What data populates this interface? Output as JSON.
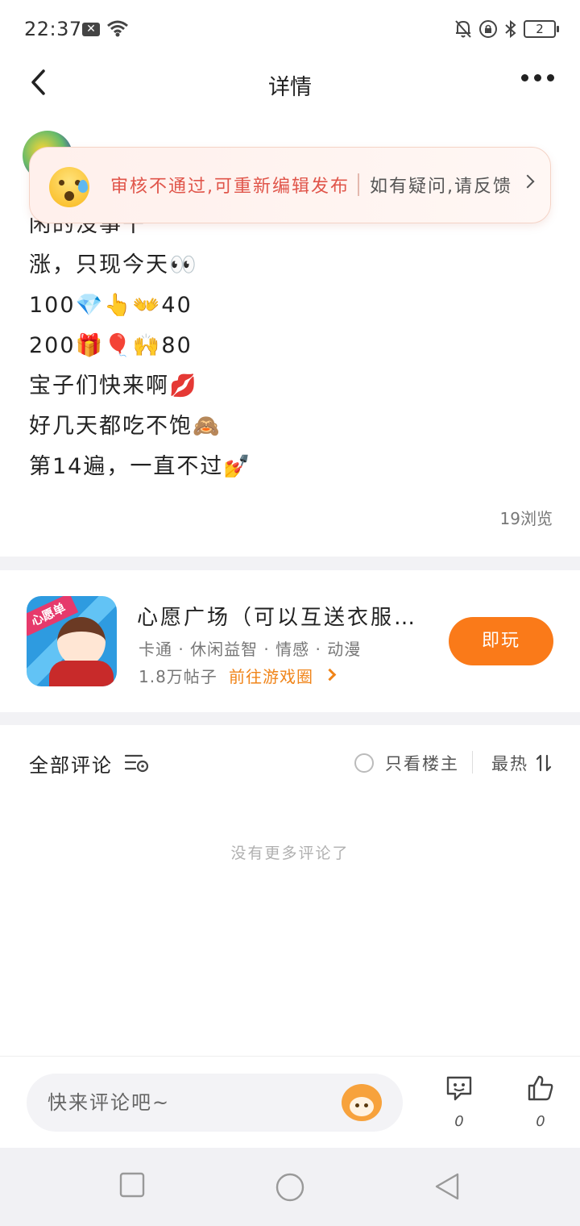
{
  "status_bar": {
    "time": "22:37",
    "notification_icon": "x-box-icon",
    "battery": "2"
  },
  "nav": {
    "title": "详情",
    "back_icon": "chevron-left-icon",
    "more_icon": "more-horizontal-icon"
  },
  "post": {
    "lines": [
      "闲的没事干",
      "涨，只现今天👀",
      "100💎👆👐40",
      "200🎁🎈🙌80",
      "宝子们快来啊💋",
      "好几天都吃不饱🙈",
      "第14遍，一直不过💅"
    ],
    "views": "19浏览"
  },
  "review_banner": {
    "message": "审核不通过,可重新编辑发布",
    "help": "如有疑问,请反馈",
    "icon": "anxious-face-icon"
  },
  "game": {
    "name": "心愿广场（可以互送衣服…",
    "tags": "卡通 · 休闲益智 · 情感 · 动漫",
    "posts": "1.8万帖子",
    "link": "前往游戏圈",
    "play_label": "即玩",
    "icon_badge": "心愿单",
    "accent_color": "#fa7a19"
  },
  "comments": {
    "title": "全部评论",
    "only_host": "只看楼主",
    "sort": "最热",
    "empty": "没有更多评论了"
  },
  "comment_bar": {
    "placeholder": "快来评论吧~",
    "comment_count": "0",
    "like_count": "0"
  }
}
